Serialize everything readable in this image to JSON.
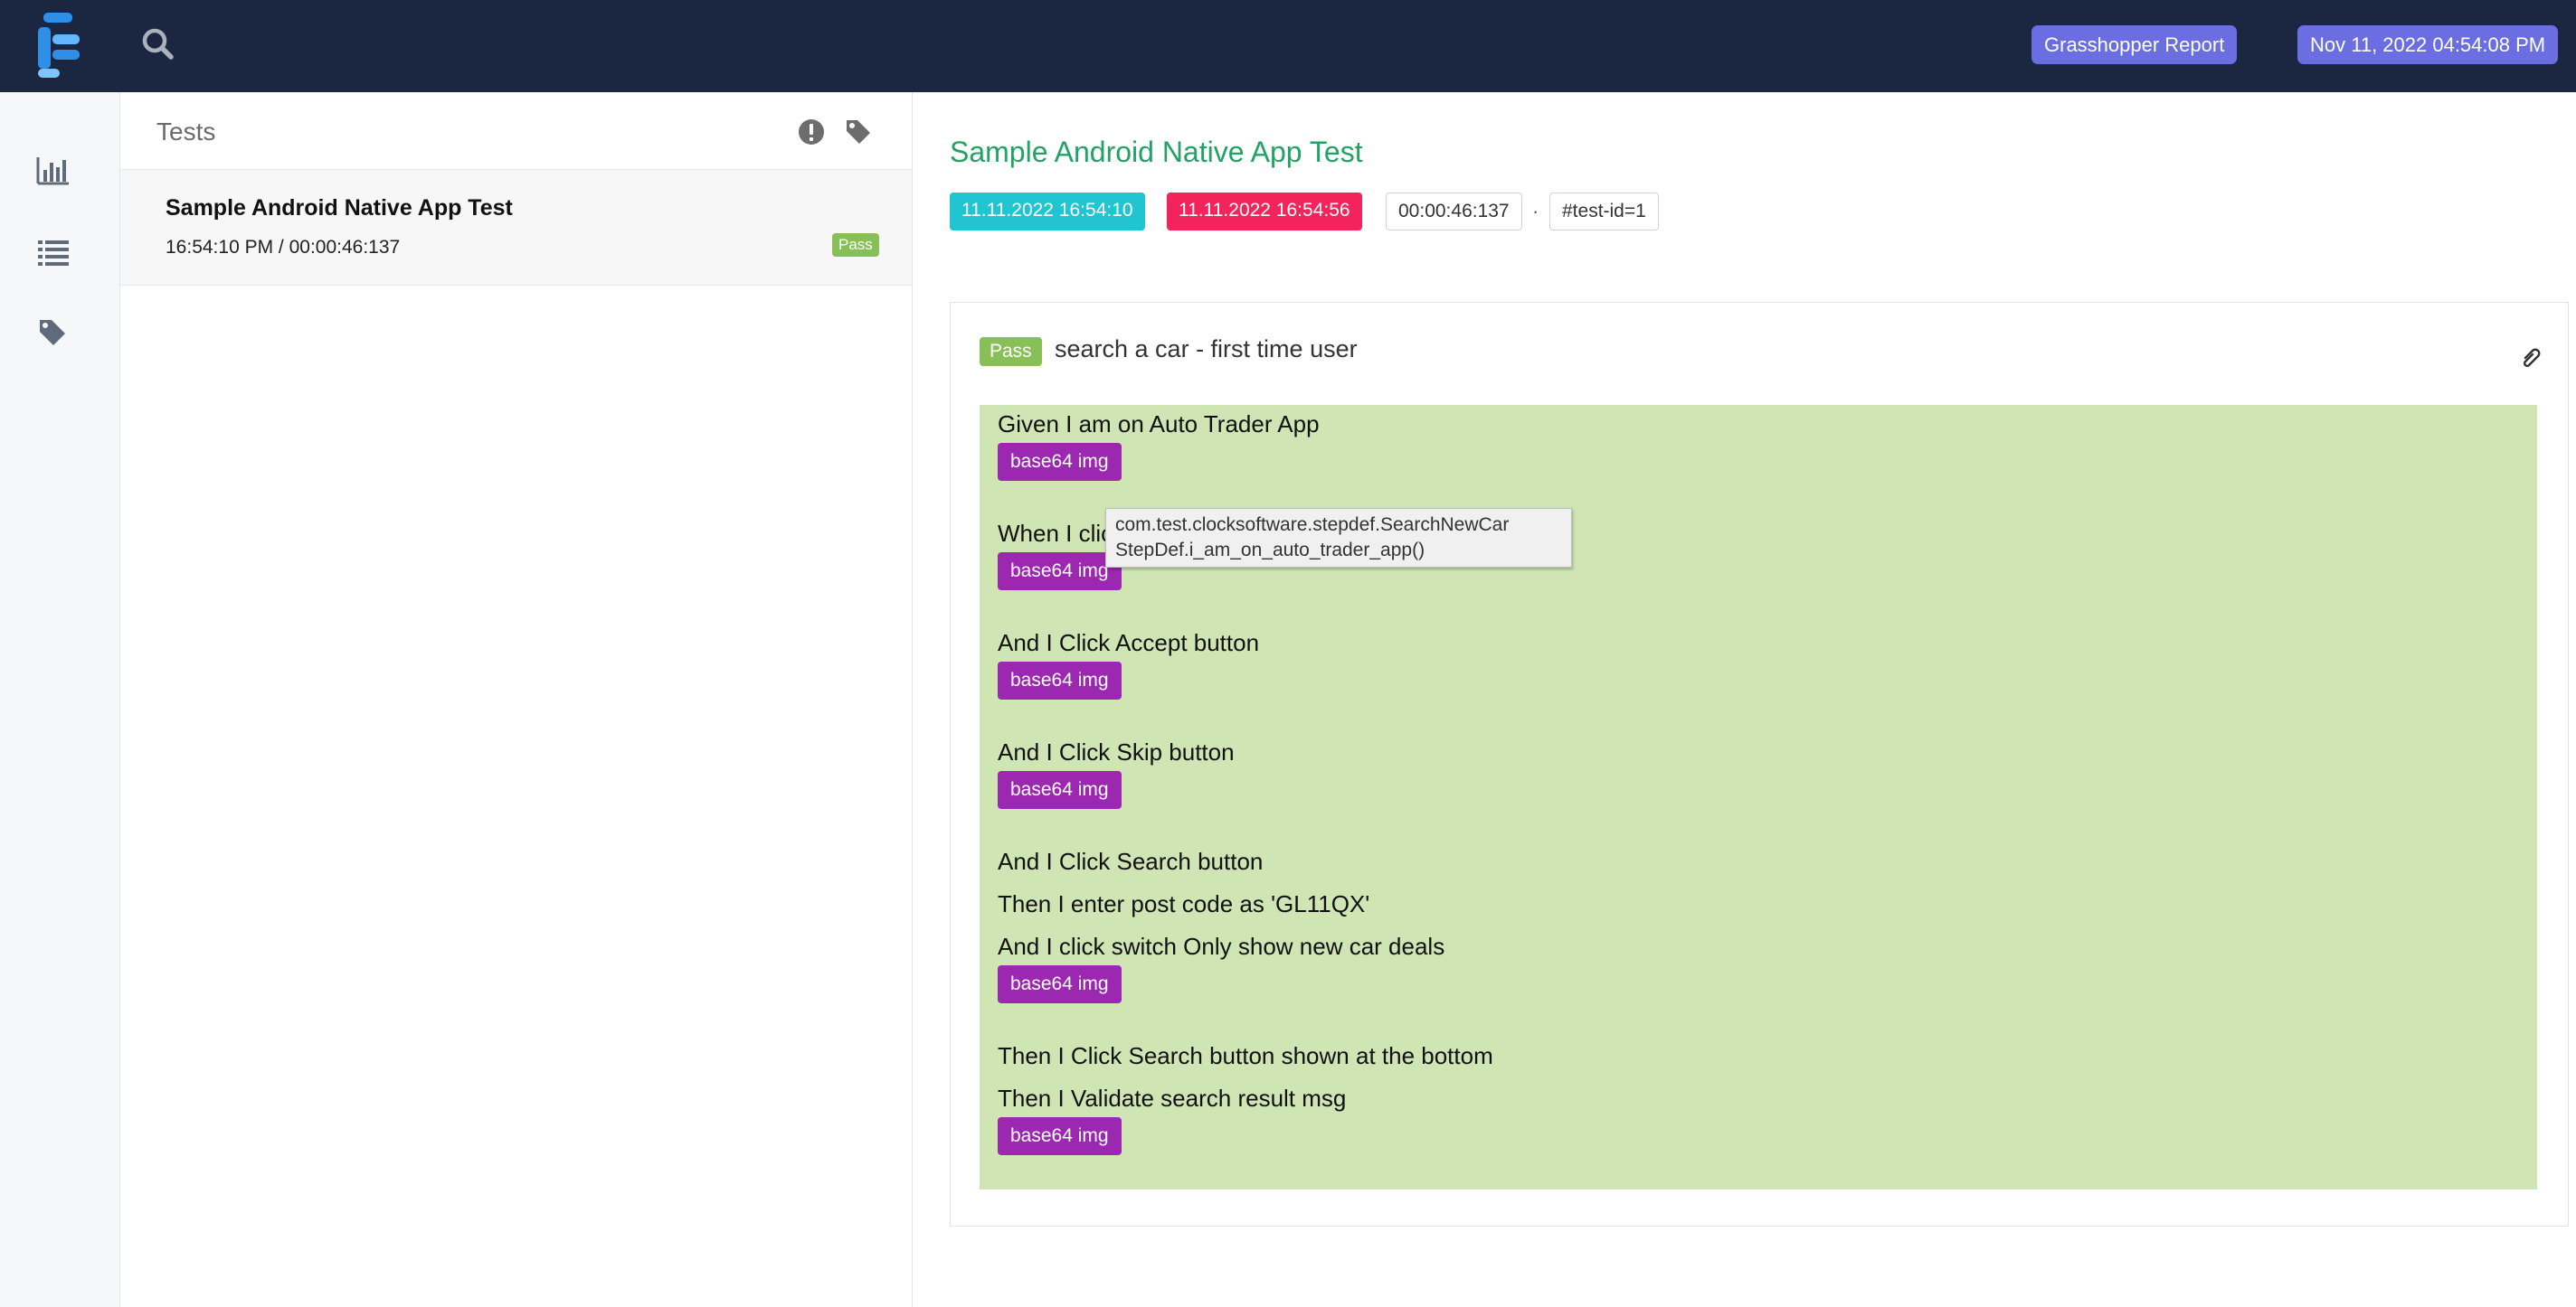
{
  "topbar": {
    "report_label": "Grasshopper Report",
    "timestamp": "Nov 11, 2022 04:54:08 PM",
    "icons": [
      "extent-logo",
      "search-icon"
    ]
  },
  "sidenav": {
    "icons": [
      "dashboard-icon",
      "list-icon",
      "tag-icon"
    ]
  },
  "testlist": {
    "title": "Tests",
    "header_icons": [
      "exclamation-icon",
      "tag-icon"
    ],
    "items": [
      {
        "name": "Sample Android Native App Test",
        "meta": "16:54:10 PM / 00:00:46:137",
        "status": "Pass"
      }
    ]
  },
  "detail": {
    "title": "Sample Android Native App Test",
    "start": "11.11.2022 16:54:10",
    "end": "11.11.2022 16:54:56",
    "duration": "00:00:46:137",
    "separator": "·",
    "test_id": "#test-id=1",
    "scenario": {
      "status": "Pass",
      "name": "search a car - first time user",
      "steps": [
        {
          "text": "Given I am on Auto Trader App",
          "attachment": "base64 img"
        },
        {
          "text": "When I click",
          "attachment": "base64 img"
        },
        {
          "text": "And I Click Accept button",
          "attachment": "base64 img"
        },
        {
          "text": "And I Click Skip button",
          "attachment": "base64 img"
        },
        {
          "text": "And I Click Search button",
          "attachment": null
        },
        {
          "text": "Then I enter post code as 'GL11QX'",
          "attachment": null
        },
        {
          "text": "And I click switch Only show new car deals",
          "attachment": "base64 img"
        },
        {
          "text": "Then I Click Search button shown at the bottom",
          "attachment": null
        },
        {
          "text": "Then I Validate search result msg",
          "attachment": "base64 img"
        }
      ]
    },
    "tooltip": {
      "line1": "com.test.clocksoftware.stepdef.SearchNewCar",
      "line2": "StepDef.i_am_on_auto_trader_app()"
    }
  },
  "colors": {
    "topbar": "#1b2740",
    "pill": "#6a6ee0",
    "title_green": "#21a366",
    "start_chip": "#21c4d1",
    "end_chip": "#f2245b",
    "pass": "#88c057",
    "steps_bg": "#cfe5b4",
    "img_badge": "#9c27b0"
  }
}
